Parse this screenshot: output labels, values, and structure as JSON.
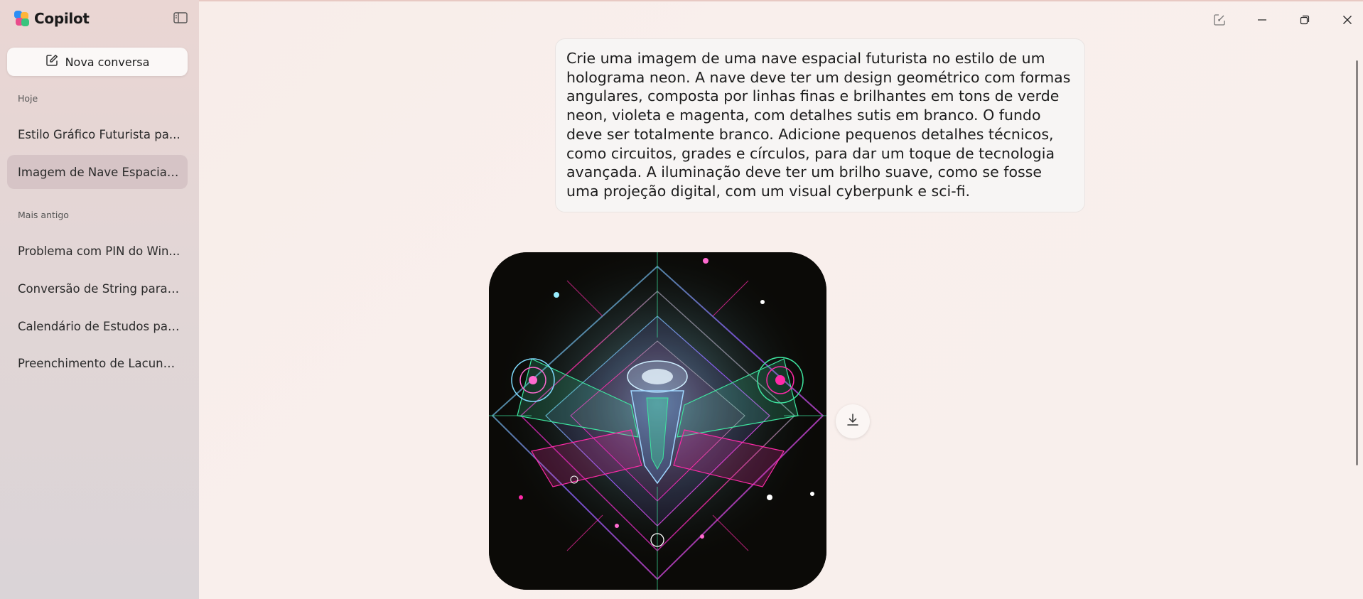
{
  "app": {
    "name": "Copilot"
  },
  "sidebar": {
    "new_chat_label": "Nova conversa",
    "sections": [
      {
        "label": "Hoje",
        "items": [
          "Estilo Gráfico Futurista pa...",
          "Imagem de Nave Espacial..."
        ]
      },
      {
        "label": "Mais antigo",
        "items": [
          "Problema com PIN do Win...",
          "Conversão de String para I...",
          "Calendário de Estudos par...",
          "Preenchimento de Lacuna..."
        ]
      }
    ],
    "active_item": "Imagem de Nave Espacial..."
  },
  "conversation": {
    "user_prompt": "Crie uma imagem de uma nave espacial futurista no estilo de um holograma neon. A nave deve ter um design geométrico com formas angulares, composta por linhas finas e brilhantes em tons de verde neon, violeta e  magenta, com detalhes sutis em branco. O fundo deve ser totalmente branco. Adicione pequenos detalhes técnicos, como circuitos, grades e círculos, para dar um toque de tecnologia avançada. A iluminação deve ter um brilho suave, como se fosse uma projeção digital, com um visual cyberpunk e sci-fi."
  },
  "icons": [
    "sidebar-toggle-icon",
    "compose-icon",
    "pop-out-icon",
    "minimize-icon",
    "restore-icon",
    "close-icon",
    "download-icon"
  ],
  "colors": {
    "neon_green": "#3ee6a0",
    "neon_violet": "#8a5cf5",
    "neon_magenta": "#ff2aa8",
    "image_bg": "#0b0a07"
  }
}
